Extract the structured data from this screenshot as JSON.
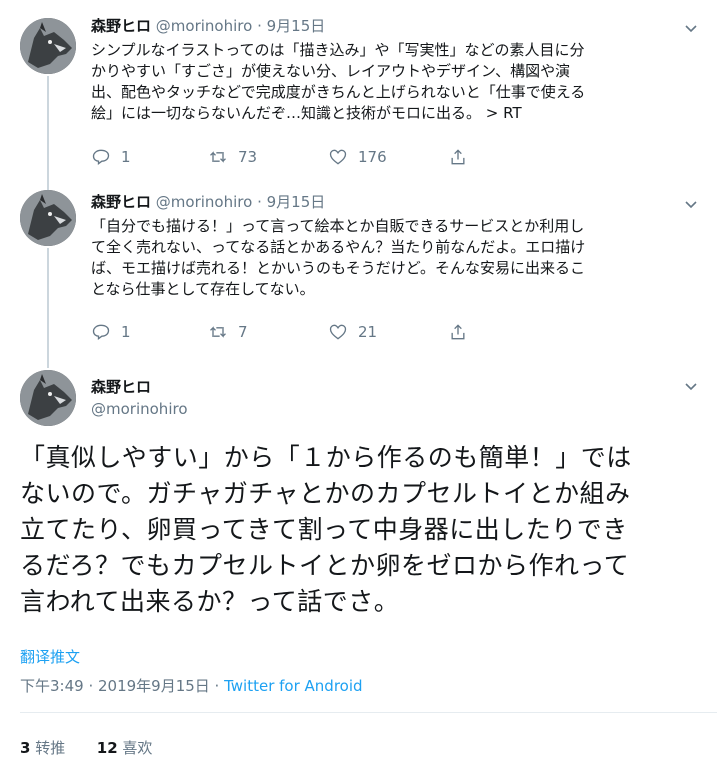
{
  "tweets": [
    {
      "name": "森野ヒロ",
      "handle": "@morinohiro",
      "dot": "·",
      "date": "9月15日",
      "text_lines": [
        "シンプルなイラストってのは「描き込み」や「写実性」などの素人目に分",
        "かりやすい「すごさ」が使えない分、レイアウトやデザイン、構図や演",
        "出、配色やタッチなどで完成度がきちんと上げられないと「仕事で使える",
        "絵」には一切ならないんだぞ…知識と技術がモロに出る。 > RT"
      ],
      "replies": "1",
      "retweets": "73",
      "likes": "176"
    },
    {
      "name": "森野ヒロ",
      "handle": "@morinohiro",
      "dot": "·",
      "date": "9月15日",
      "text_lines": [
        "「自分でも描ける！」って言って絵本とか自販できるサービスとか利用し",
        "て全く売れない、ってなる話とかあるやん？当たり前なんだよ。エロ描け",
        "ば、モエ描けば売れる！とかいうのもそうだけど。そんな安易に出来るこ",
        "となら仕事として存在してない。"
      ],
      "replies": "1",
      "retweets": "7",
      "likes": "21"
    }
  ],
  "main": {
    "name": "森野ヒロ",
    "handle": "@morinohiro",
    "text_lines": [
      "「真似しやすい」から「１から作るのも簡単！」では",
      "ないので。ガチャガチャとかのカプセルトイとか組み",
      "立てたり、卵買ってきて割って中身器に出したりでき",
      "るだろ？でもカプセルトイとか卵をゼロから作れって",
      "言われて出来るか？って話でさ。"
    ],
    "translate": "翻译推文",
    "time": "下午3:49 · 2019年9月15日 · ",
    "source": "Twitter for Android",
    "retweet_count": "3",
    "retweet_label": " 转推",
    "like_count": "12",
    "like_label": " 喜欢"
  },
  "icons": {
    "reply": "reply-icon",
    "retweet": "retweet-icon",
    "like": "heart-icon",
    "share": "share-icon",
    "more": "chevron-down-icon"
  },
  "colors": {
    "link": "#1da1f2",
    "secondary": "#657786",
    "text": "#14171a"
  }
}
